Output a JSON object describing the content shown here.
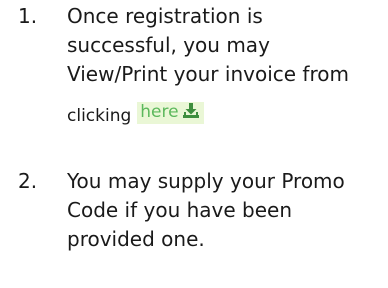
{
  "steps": [
    {
      "number": "1.",
      "lines": [
        "Once registration is",
        "successful, you may",
        "View/Print your invoice from"
      ],
      "clicking": "clicking",
      "link": {
        "label": "here",
        "icon": "download-icon"
      }
    },
    {
      "number": "2.",
      "lines": [
        "You may supply your Promo",
        "Code if you have been",
        "provided one."
      ]
    }
  ],
  "colors": {
    "link_text": "#5cb85c",
    "link_bg": "#eaf7d6"
  }
}
